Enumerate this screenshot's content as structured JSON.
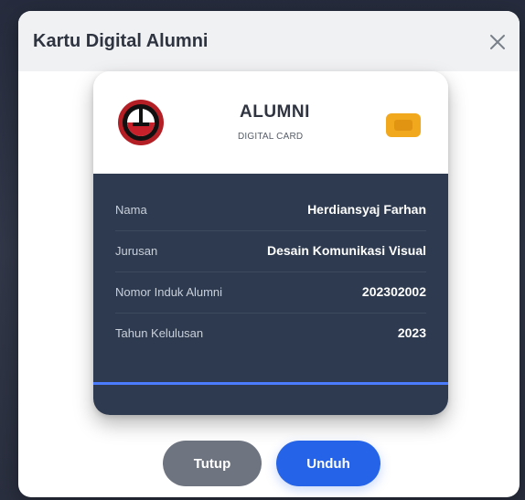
{
  "modal": {
    "title": "Kartu Digital Alumni",
    "close_icon": "close-icon"
  },
  "card": {
    "heading": "ALUMNI",
    "subheading": "DIGITAL CARD",
    "logo_icon": "institution-logo",
    "chip_icon": "card-chip-icon",
    "details": [
      {
        "label": "Nama",
        "value": "Herdiansyaj Farhan"
      },
      {
        "label": "Jurusan",
        "value": "Desain Komunikasi Visual"
      },
      {
        "label": "Nomor Induk Alumni",
        "value": "202302002"
      },
      {
        "label": "Tahun Kelulusan",
        "value": "2023"
      }
    ]
  },
  "footer": {
    "close_button": "Tutup",
    "download_button": "Unduh"
  },
  "colors": {
    "card_body": "#2d3a4f",
    "chip": "#f2a81d",
    "primary_button": "#2563e8",
    "secondary_button": "#6e7480",
    "accent_line": "#4b7cff"
  }
}
